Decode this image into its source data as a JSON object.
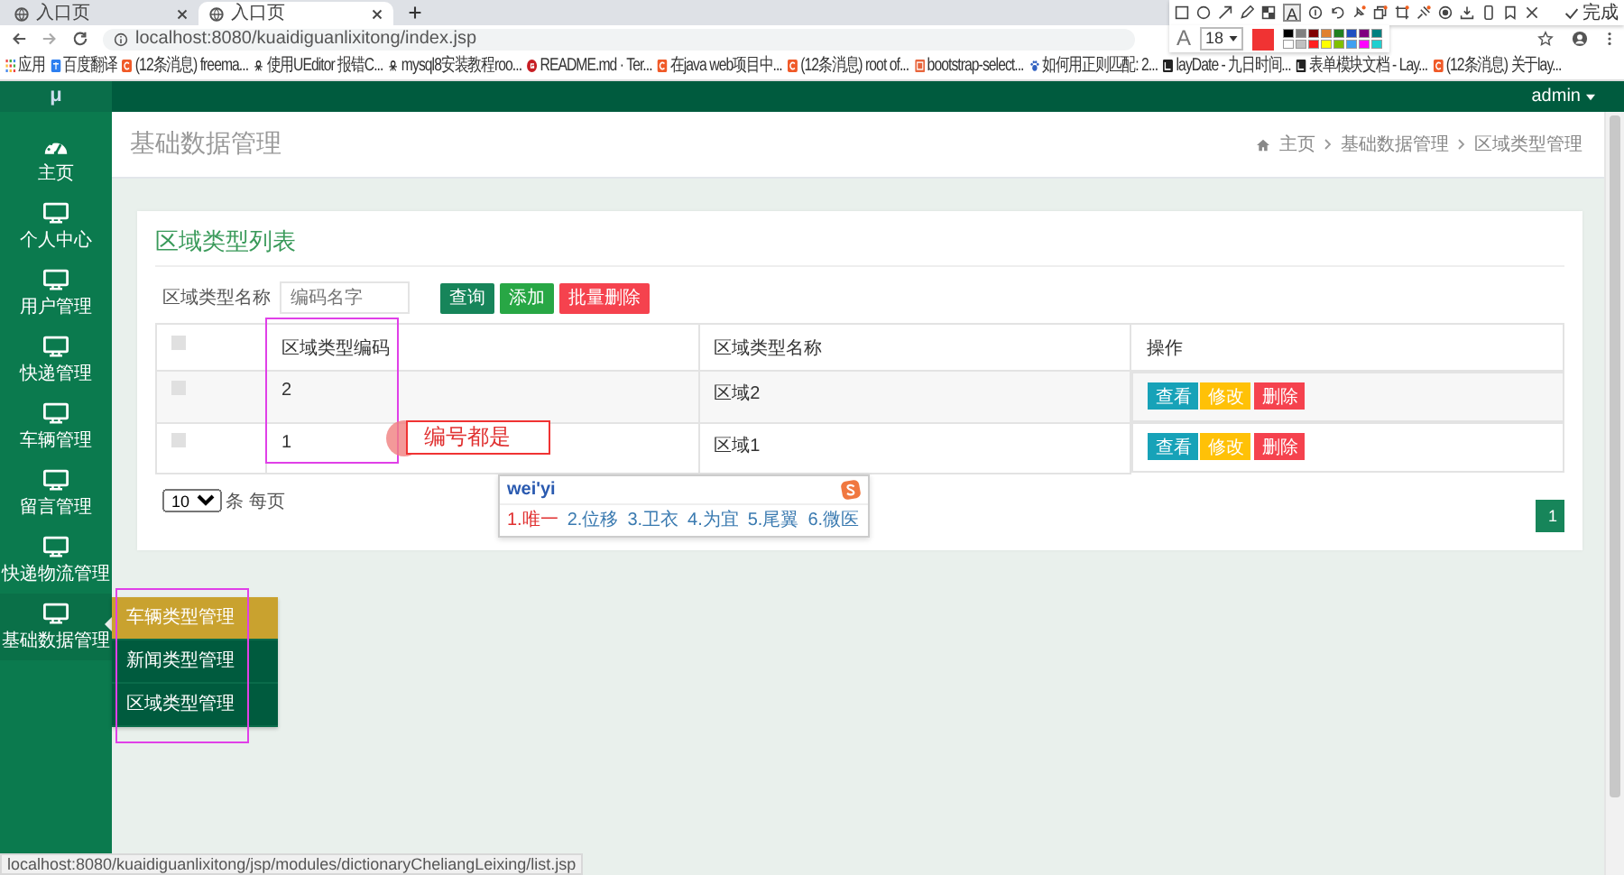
{
  "browser": {
    "tabs": [
      {
        "title": "入口页",
        "selected": false
      },
      {
        "title": "入口页",
        "selected": true
      }
    ],
    "url": "localhost:8080/kuaidiguanlixitong/index.jsp",
    "bookmarks": [
      {
        "label": "应用",
        "kind": "apps"
      },
      {
        "label": "百度翻译",
        "kind": "translate"
      },
      {
        "label": "(12条消息) freema...",
        "kind": "csdn"
      },
      {
        "label": "使用UEditor 报错C...",
        "kind": "spider"
      },
      {
        "label": "mysql8安装教程roo...",
        "kind": "spider"
      },
      {
        "label": "README.md · Ter...",
        "kind": "gitee"
      },
      {
        "label": "在java web项目中...",
        "kind": "csdn"
      },
      {
        "label": "(12条消息) root of...",
        "kind": "csdn"
      },
      {
        "label": "bootstrap-select...",
        "kind": "box"
      },
      {
        "label": "如何用正则匹配: 2...",
        "kind": "paw"
      },
      {
        "label": "layDate - 九日时间...",
        "kind": "lay"
      },
      {
        "label": "表单模块文档 - Lay...",
        "kind": "lay"
      },
      {
        "label": "(12条消息) 关于lay...",
        "kind": "csdn"
      }
    ],
    "status_url": "localhost:8080/kuaidiguanlixitong/jsp/modules/dictionaryCheliangLeixing/list.jsp"
  },
  "capture_toolbar": {
    "text_tool": "A",
    "done": "完成",
    "font_letter": "A",
    "font_size": "18",
    "palette": [
      {
        "color": "#000000"
      },
      {
        "color": "#808080"
      },
      {
        "color": "#800000"
      },
      {
        "color": "#e08030"
      },
      {
        "color": "#208020"
      },
      {
        "color": "#2050c0"
      },
      {
        "color": "#800080"
      },
      {
        "color": "#008080"
      },
      {
        "color": "#ffffff"
      },
      {
        "color": "#c0c0c0"
      },
      {
        "color": "#ff2020"
      },
      {
        "color": "#ffff00"
      },
      {
        "color": "#80c000"
      },
      {
        "color": "#40a0f0"
      },
      {
        "color": "#ff00ff"
      },
      {
        "color": "#20d0d0"
      }
    ]
  },
  "app": {
    "logo": "μ",
    "user": "admin",
    "sidebar": [
      {
        "label": "主页",
        "kind": "dashboard",
        "selected": false
      },
      {
        "label": "个人中心",
        "kind": "monitor",
        "selected": false
      },
      {
        "label": "用户管理",
        "kind": "monitor",
        "selected": false
      },
      {
        "label": "快递管理",
        "kind": "monitor",
        "selected": false
      },
      {
        "label": "车辆管理",
        "kind": "monitor",
        "selected": false
      },
      {
        "label": "留言管理",
        "kind": "monitor",
        "selected": false
      },
      {
        "label": "快递物流管理",
        "kind": "monitor",
        "selected": false
      },
      {
        "label": "基础数据管理",
        "kind": "monitor",
        "selected": true
      }
    ],
    "submenu": [
      {
        "label": "车辆类型管理",
        "selected": true
      },
      {
        "label": "新闻类型管理",
        "selected": false
      },
      {
        "label": "区域类型管理",
        "selected": false
      }
    ]
  },
  "page": {
    "title": "基础数据管理",
    "breadcrumb": [
      "主页",
      "基础数据管理",
      "区域类型管理"
    ]
  },
  "card": {
    "title": "区域类型列表",
    "search": {
      "label": "区域类型名称",
      "placeholder": "编码名字"
    },
    "buttons": [
      {
        "label": "查询",
        "kind": "search"
      },
      {
        "label": "添加",
        "kind": "add"
      },
      {
        "label": "批量删除",
        "kind": "delete"
      }
    ],
    "table": {
      "select_all_checked": false,
      "columns": [
        "区域类型编码",
        "区域类型名称",
        "操作"
      ],
      "rows": [
        {
          "checked": false,
          "code": "2",
          "name": "区域2",
          "actions": [
            {
              "label": "查看",
              "kind": "view"
            },
            {
              "label": "修改",
              "kind": "edit"
            },
            {
              "label": "删除",
              "kind": "delete"
            }
          ]
        },
        {
          "checked": false,
          "code": "1",
          "name": "区域1",
          "actions": [
            {
              "label": "查看",
              "kind": "view"
            },
            {
              "label": "修改",
              "kind": "edit"
            },
            {
              "label": "删除",
              "kind": "delete"
            }
          ]
        }
      ]
    },
    "page_size": "10",
    "page_size_label": "条 每页",
    "pages": [
      {
        "label": "1",
        "selected": true
      }
    ]
  },
  "annotations": {
    "note": "编号都是",
    "ime": {
      "input": "wei'yi",
      "candidates": [
        "1.唯一",
        "2.位移",
        "3.卫衣",
        "4.为宜",
        "5.尾翼",
        "6.微医"
      ]
    }
  }
}
